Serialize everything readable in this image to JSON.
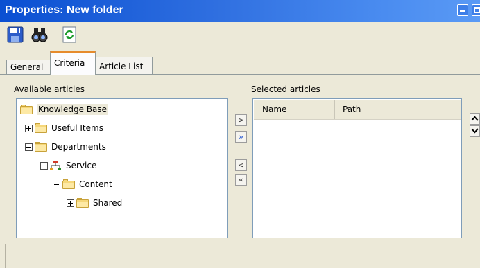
{
  "window": {
    "title": "Properties: New folder"
  },
  "toolbar": {
    "save_icon": "floppy-disk-icon",
    "properties_icon": "binoculars-icon",
    "refresh_icon": "refresh-page-icon"
  },
  "tabs": [
    {
      "label": "General"
    },
    {
      "label": "Criteria",
      "active": true
    },
    {
      "label": "Article List"
    }
  ],
  "available": {
    "label": "Available articles",
    "tree": [
      {
        "label": "Knowledge Base",
        "icon": "folder-icon",
        "state": "none",
        "selected": true
      },
      {
        "label": "Useful Items",
        "icon": "folder-icon",
        "state": "collapsed"
      },
      {
        "label": "Departments",
        "icon": "folder-icon",
        "state": "expanded"
      },
      {
        "label": "Service",
        "icon": "org-chart-icon",
        "state": "expanded"
      },
      {
        "label": "Content",
        "icon": "folder-icon",
        "state": "expanded"
      },
      {
        "label": "Shared",
        "icon": "folder-icon",
        "state": "collapsed"
      }
    ]
  },
  "transfer": {
    "add": ">",
    "add_all": "»",
    "remove": "<",
    "remove_all": "«"
  },
  "selected": {
    "label": "Selected articles",
    "columns": [
      "Name",
      "Path"
    ]
  },
  "order": {
    "up": "^",
    "down": "v"
  },
  "colors": {
    "title_bar": "#0a4fd2",
    "dialog_bg": "#ece9d8",
    "tab_accent": "#e68b2c"
  }
}
